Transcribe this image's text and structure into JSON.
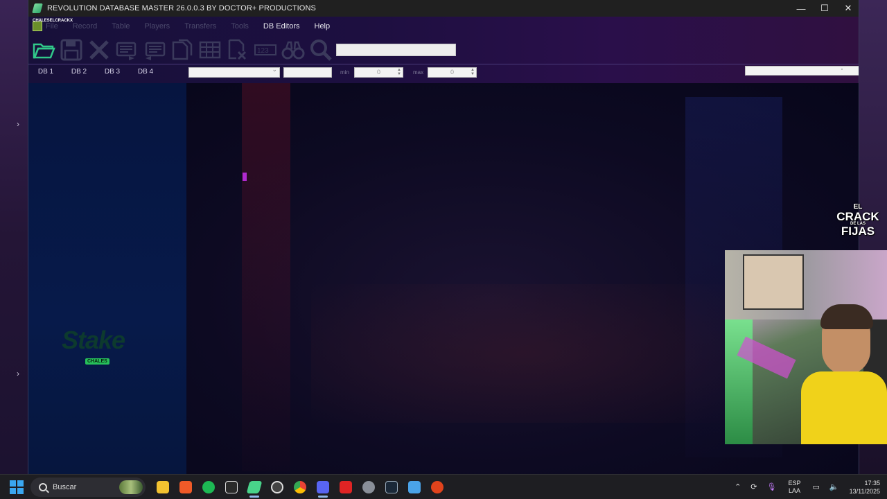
{
  "window": {
    "title": "REVOLUTION DATABASE MASTER 26.0.0.3 BY DOCTOR+ PRODUCTIONS",
    "controls": {
      "minimize": "—",
      "maximize": "☐",
      "close": "✕"
    }
  },
  "menu": {
    "brand_mini": "CHALESELCRACKX",
    "items": [
      "File",
      "Record",
      "Table",
      "Players",
      "Transfers",
      "Tools",
      "DB Editors",
      "Help"
    ]
  },
  "toolbar": {
    "icons": [
      "open-folder-icon",
      "save-icon",
      "close-x-icon",
      "list-forward-icon",
      "list-back-icon",
      "copy-pages-icon",
      "grid-icon",
      "delete-doc-icon",
      "numbers-icon",
      "binoculars-icon",
      "search-icon"
    ],
    "search_value": ""
  },
  "db_tabs": [
    "DB 1",
    "DB 2",
    "DB 3",
    "DB 4"
  ],
  "filters": {
    "select_value": "",
    "text_value": "",
    "min_label": "min",
    "min_value": "0",
    "max_label": "max",
    "max_value": "0"
  },
  "sponsor": {
    "name": "Stake",
    "badge": "CHALES"
  },
  "overlay": {
    "line1": "EL",
    "line2": "CRACK",
    "line3": "FIJAS",
    "small": "DE LAS"
  },
  "taskbar": {
    "search_placeholder": "Buscar",
    "apps": [
      "file-explorer-icon",
      "brave-icon",
      "spotify-icon",
      "mm-icon",
      "database-master-icon",
      "app-icon",
      "chrome-icon",
      "discord-icon",
      "app-red-icon",
      "settings-icon",
      "steam-icon",
      "notepad-icon",
      "app-orange-icon"
    ],
    "lang_top": "ESP",
    "lang_bottom": "LAA",
    "time": "17:35",
    "date": "13/11/2025"
  },
  "colors": {
    "accent_green": "#27c05a",
    "titlebar": "#202020",
    "taskbar": "#1e1e22"
  }
}
